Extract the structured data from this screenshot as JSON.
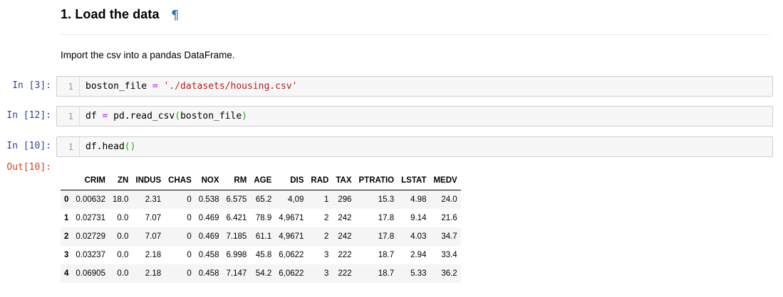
{
  "heading": {
    "title": "1. Load the data",
    "anchor": "¶"
  },
  "markdown": {
    "text": "Import the csv into a pandas DataFrame."
  },
  "cells": [
    {
      "prompt": "In [3]:",
      "line_no": "1",
      "code": {
        "var": "boston_file",
        "op": "=",
        "str": "'./datasets/housing.csv'"
      }
    },
    {
      "prompt": "In [12]:",
      "line_no": "1",
      "code": {
        "lhs": "df",
        "op": "=",
        "call": "pd.read_csv",
        "lpar": "(",
        "arg": "boston_file",
        "rpar": ")"
      }
    },
    {
      "prompt": "In [10]:",
      "line_no": "1",
      "code": {
        "call": "df.head",
        "parens": "()"
      }
    }
  ],
  "output": {
    "prompt": "Out[10]:",
    "table": {
      "columns": [
        "",
        "CRIM",
        "ZN",
        "INDUS",
        "CHAS",
        "NOX",
        "RM",
        "AGE",
        "DIS",
        "RAD",
        "TAX",
        "PTRATIO",
        "LSTAT",
        "MEDV"
      ],
      "rows": [
        [
          "0",
          "0.00632",
          "18.0",
          "2.31",
          "0",
          "0.538",
          "6.575",
          "65.2",
          "4,09",
          "1",
          "296",
          "15.3",
          "4.98",
          "24.0"
        ],
        [
          "1",
          "0.02731",
          "0.0",
          "7.07",
          "0",
          "0.469",
          "6.421",
          "78.9",
          "4,9671",
          "2",
          "242",
          "17.8",
          "9.14",
          "21.6"
        ],
        [
          "2",
          "0.02729",
          "0.0",
          "7.07",
          "0",
          "0.469",
          "7.185",
          "61.1",
          "4,9671",
          "2",
          "242",
          "17.8",
          "4.03",
          "34.7"
        ],
        [
          "3",
          "0.03237",
          "0.0",
          "2.18",
          "0",
          "0.458",
          "6.998",
          "45.8",
          "6,0622",
          "3",
          "222",
          "18.7",
          "2.94",
          "33.4"
        ],
        [
          "4",
          "0.06905",
          "0.0",
          "2.18",
          "0",
          "0.458",
          "7.147",
          "54.2",
          "6,0622",
          "3",
          "222",
          "18.7",
          "5.33",
          "36.2"
        ]
      ]
    }
  }
}
